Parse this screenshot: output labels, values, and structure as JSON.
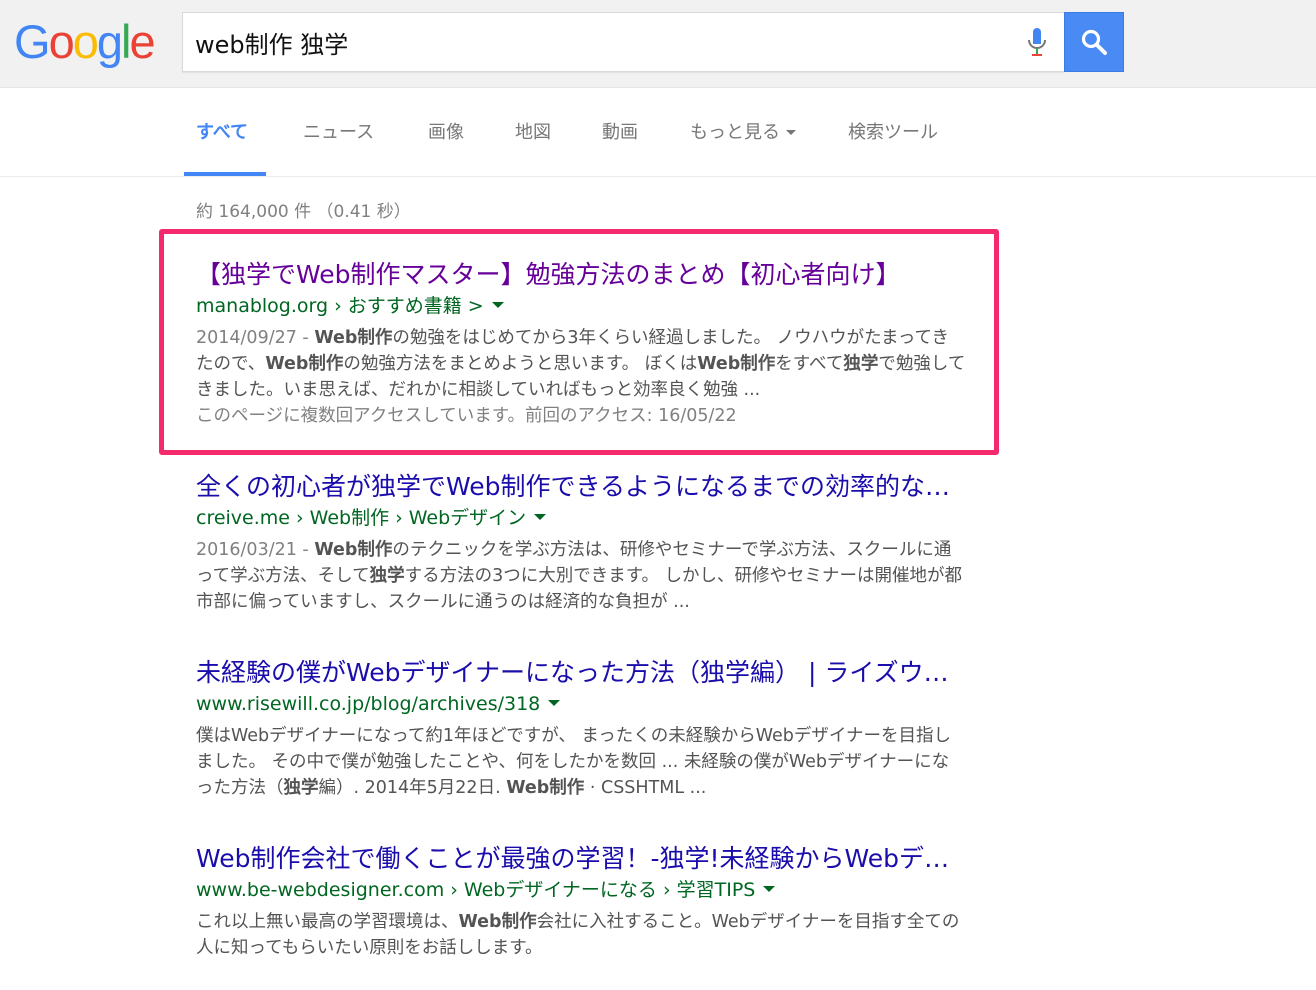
{
  "header": {
    "logo_letters": [
      "G",
      "o",
      "o",
      "g",
      "l",
      "e"
    ],
    "search_value": "web制作 独学",
    "mic_icon": "microphone-icon",
    "search_icon": "magnifier-icon"
  },
  "tabs": [
    {
      "label": "すべて"
    },
    {
      "label": "ニュース"
    },
    {
      "label": "画像"
    },
    {
      "label": "地図"
    },
    {
      "label": "動画"
    },
    {
      "label": "もっと見る"
    },
    {
      "label": "検索ツール"
    }
  ],
  "stats": "約 164,000 件 （0.41 秒）",
  "results": [
    {
      "title": "【独学でWeb制作マスター】勉強方法のまとめ【初心者向け】",
      "url": "manablog.org › おすすめ書籍 >",
      "date": "2014/09/27 - ",
      "snippet_parts": [
        {
          "t": "Web制作",
          "b": true
        },
        {
          "t": "の勉強をはじめてから3年くらい経過しました。 ノウハウがたまってきたので、",
          "b": false
        },
        {
          "t": "Web制作",
          "b": true
        },
        {
          "t": "の勉強方法をまとめようと思います。 ぼくは",
          "b": false
        },
        {
          "t": "Web制作",
          "b": true
        },
        {
          "t": "をすべて",
          "b": false
        },
        {
          "t": "独学",
          "b": true
        },
        {
          "t": "で勉強してきました。いま思えば、だれかに相談していればもっと効率良く勉強 ...",
          "b": false
        }
      ],
      "visit_note": "このページに複数回アクセスしています。前回のアクセス: 16/05/22"
    },
    {
      "title": "全くの初心者が独学でWeb制作できるようになるまでの効率的な勉強法",
      "url": "creive.me › Web制作 › Webデザイン",
      "date": "2016/03/21 - ",
      "snippet_parts": [
        {
          "t": "Web制作",
          "b": true
        },
        {
          "t": "のテクニックを学ぶ方法は、研修やセミナーで学ぶ方法、スクールに通って学ぶ方法、そして",
          "b": false
        },
        {
          "t": "独学",
          "b": true
        },
        {
          "t": "する方法の3つに大別できます。 しかし、研修やセミナーは開催地が都市部に偏っていますし、スクールに通うのは経済的な負担が ...",
          "b": false
        }
      ]
    },
    {
      "title": "未経験の僕がWebデザイナーになった方法（独学編） | ライズウィル",
      "url": "www.risewill.co.jp/blog/archives/318",
      "date": "",
      "snippet_parts": [
        {
          "t": "僕はWebデザイナーになって約1年ほどですが、 まったくの未経験からWebデザイナーを目指しました。 その中で僕が勉強したことや、何をしたかを数回 ... 未経験の僕がWebデザイナーになった方法（",
          "b": false
        },
        {
          "t": "独学",
          "b": true
        },
        {
          "t": "編）. 2014年5月22日. ",
          "b": false
        },
        {
          "t": "Web制作",
          "b": true
        },
        {
          "t": " · CSSHTML ...",
          "b": false
        }
      ]
    },
    {
      "title": "Web制作会社で働くことが最強の学習！-独学!未経験からWebデザイナー",
      "url": "www.be-webdesigner.com › Webデザイナーになる › 学習TIPS",
      "date": "",
      "snippet_parts": [
        {
          "t": "これ以上無い最高の学習環境は、",
          "b": false
        },
        {
          "t": "Web制作",
          "b": true
        },
        {
          "t": "会社に入社すること。Webデザイナーを目指す全ての人に知ってもらいたい原則をお話しします。",
          "b": false
        }
      ]
    }
  ]
}
